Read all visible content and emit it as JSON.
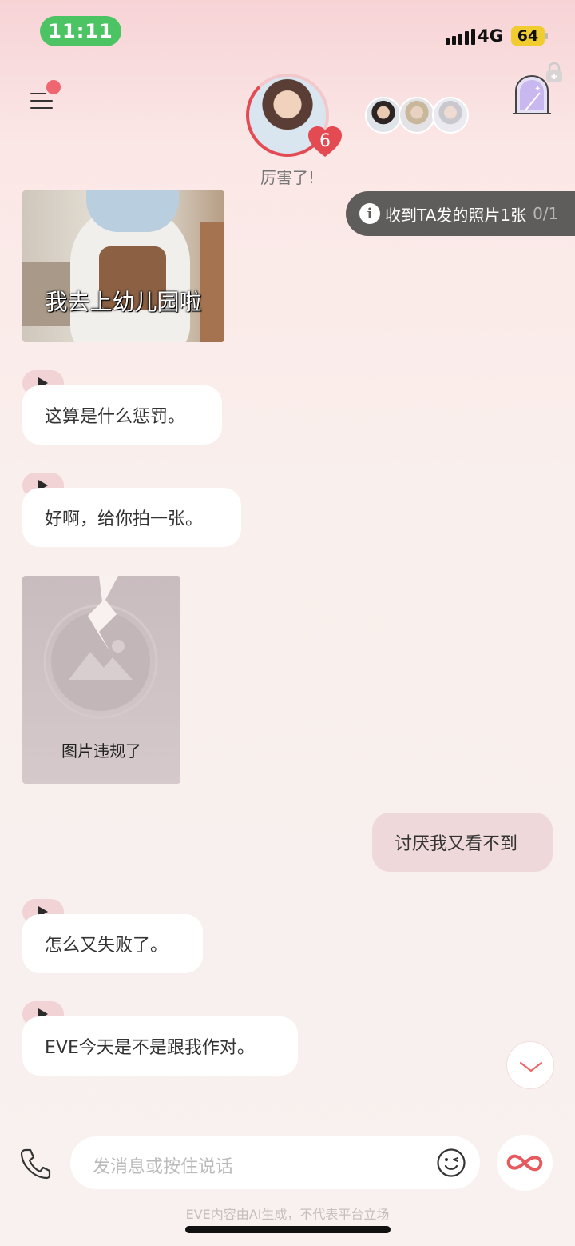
{
  "status_bar": {
    "time": "11:11",
    "network": "4G",
    "battery": "64"
  },
  "header": {
    "menu_icon": "menu-icon",
    "character_mood": "厉害了!",
    "heart_count": "6",
    "locked_room_icon": "arched-door-icon"
  },
  "notice": {
    "text": "收到TA发的照片1张",
    "count": "0/1"
  },
  "messages": {
    "photo_caption": "我去上幼儿园啦",
    "m1": "这算是什么惩罚。",
    "m2": "好啊，给你拍一张。",
    "broken_image_label": "图片违规了",
    "m3_me": "讨厌我又看不到",
    "m4": "怎么又失败了。",
    "m5": "EVE今天是不是跟我作对。"
  },
  "input_bar": {
    "placeholder": "发消息或按住说话",
    "phone_icon": "phone-icon",
    "emoji_icon": "emoji-icon",
    "action_icon": "infinity-icon"
  },
  "footer": {
    "disclaimer": "EVE内容由AI生成，不代表平台立场"
  },
  "colors": {
    "accent": "#e34a52",
    "user_bubble": "#eed8d9",
    "status_green": "#4cc463"
  }
}
